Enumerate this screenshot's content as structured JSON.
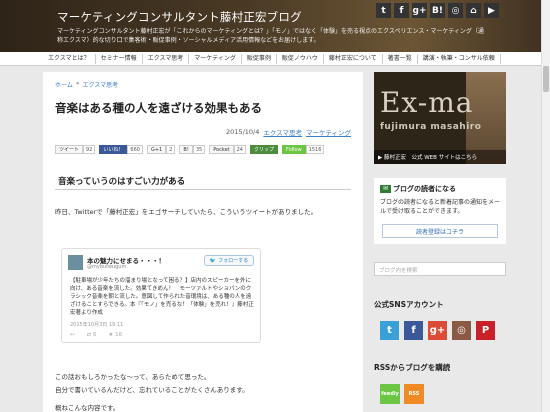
{
  "header": {
    "title": "マーケティングコンサルタント藤村正宏ブログ",
    "description": "マーケティングコンサルタント藤村正宏が「これからのマーケティングとは？」「モノ」ではなく「体験」を売る視点のエクスペリエンス・マーケティング（通称エクスマ）的な切り口で集客術・販促事例・ソーシャルメディア活用情報などをお届けします。",
    "social_icons": [
      {
        "name": "twitter-icon",
        "glyph": "t",
        "color": "#333333"
      },
      {
        "name": "facebook-icon",
        "glyph": "f",
        "color": "#333333"
      },
      {
        "name": "googleplus-icon",
        "glyph": "g+",
        "color": "#333333"
      },
      {
        "name": "hatena-icon",
        "glyph": "B!",
        "color": "#333333"
      },
      {
        "name": "instagram-icon",
        "glyph": "◎",
        "color": "#333333"
      },
      {
        "name": "feedly-icon",
        "glyph": "⌂",
        "color": "#333333"
      },
      {
        "name": "youtube-icon",
        "glyph": "▶",
        "color": "#333333"
      }
    ]
  },
  "nav": {
    "items": [
      "エクスマとは？",
      "セミナー情報",
      "エクスマ思考",
      "マーケティング",
      "販促事例",
      "販促ノウハウ",
      "藤村正宏について",
      "著書一覧",
      "講演・執筆・コンサル依頼"
    ]
  },
  "article": {
    "breadcrumb_home": "ホーム",
    "breadcrumb_sep": "»",
    "breadcrumb_category": "エクスマ思考",
    "title": "音楽はある種の人を遠ざける効果もある",
    "date": "2015/10/4",
    "tags": [
      "エクスマ思考",
      "マーケティング"
    ],
    "share_buttons": [
      {
        "label": "ツイート",
        "count": "92",
        "style": "plain"
      },
      {
        "label": "いいね！",
        "count": "660",
        "style": "fb"
      },
      {
        "label": "G+1",
        "count": "2",
        "style": "plain"
      },
      {
        "label": "B!",
        "count": "35",
        "style": "plain"
      },
      {
        "label": "Pocket",
        "count": "24",
        "style": "plain"
      },
      {
        "label": "クリップ",
        "count": "",
        "style": "clip"
      },
      {
        "label": "Follow",
        "count": "1516",
        "style": "follow"
      }
    ],
    "section_heading": "音楽っていうのはすごい力がある",
    "para1": "昨日、Twitterで「藤村正宏」をエゴサーチしていたら、こういうツイートがありました。",
    "tweet": {
      "name": "本の魅力にせまる・・・！",
      "handle": "@mybufwugum",
      "follow_label": "フォローする",
      "text": "【駐車場が少年たちの溜まり場となって困る？】店内のスピーカーを外に向け、ある音楽を流した。効果てきめん！　モーツァルトやショパンのクラシック音楽を朝と流した。意図して作られた音環境は、ある種の人を遠ざけることすらできる。本『「モノ」を売るな！「体験」を売れ！』藤村正宏著より作成",
      "date": "2015年10月3日 19:11",
      "retweets": "6",
      "likes": "16"
    },
    "para2": "この話おもしろかったな〜って、あらためて思った。",
    "para3": "自分で書いているんだけど、忘れていることがたくさんあります。",
    "para4": "概ねこんな内容です。"
  },
  "sidebar": {
    "ad_title": "Ex-ma",
    "ad_name": "fujimura masahiro",
    "ad_caption": "藤村正宏　公式 WEB サイトはこちら",
    "reader_title": "ブログの読者になる",
    "reader_desc": "ブログの読者になると新着記事の通知をメールで受け取ることができます。",
    "reader_button": "読者登録はコチラ",
    "search_placeholder": "ブログ内を検索",
    "sns_title": "公式SNSアカウント",
    "sns_icons": [
      {
        "name": "twitter-icon",
        "glyph": "t",
        "color": "#3aa0d8"
      },
      {
        "name": "facebook-icon",
        "glyph": "f",
        "color": "#3b5998"
      },
      {
        "name": "googleplus-icon",
        "glyph": "g+",
        "color": "#dc4a38"
      },
      {
        "name": "instagram-icon",
        "glyph": "◎",
        "color": "#8a5a44"
      },
      {
        "name": "pinterest-icon",
        "glyph": "P",
        "color": "#cb2027"
      }
    ],
    "rss_title": "RSSからブログを購読",
    "rss_icons": [
      {
        "name": "feedly-icon",
        "label": "feedly",
        "color": "#6cc644"
      },
      {
        "name": "rss-icon",
        "label": "RSS",
        "color": "#f08a24"
      }
    ]
  }
}
